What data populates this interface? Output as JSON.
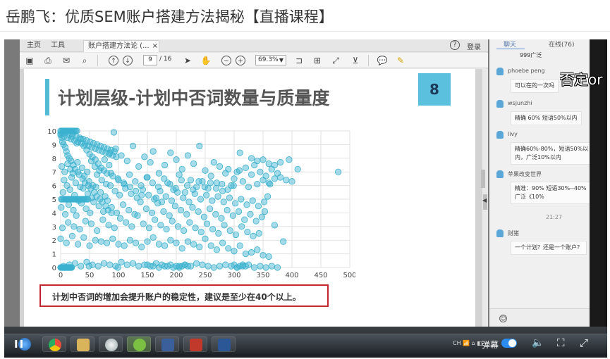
{
  "page": {
    "title": "岳鹏飞：优质SEM账户搭建方法揭秘【直播课程】"
  },
  "pdf": {
    "tabs": {
      "home": "主页",
      "tools": "工具",
      "doc": "账户搭建方法论 (...",
      "close": "×"
    },
    "help": "?",
    "login": "登录",
    "page_current": "9",
    "page_total": "/ 16",
    "zoom": "69.3%",
    "icons": [
      "save-icon",
      "print-icon",
      "mail-icon",
      "search-icon",
      "up-arrow-icon",
      "down-arrow-icon",
      "pointer-icon",
      "hand-icon",
      "zoom-out-icon",
      "zoom-in-icon",
      "fit-page-icon",
      "fit-width-icon",
      "fullscreen-icon",
      "tools-icon",
      "comment-icon",
      "highlighter-icon"
    ]
  },
  "slide": {
    "number": "8",
    "title": "计划层级-计划中否词数量与质量度",
    "note": "计划中否词的增加会提升账户的稳定性，建议是至少在40个以上。"
  },
  "chart_data": {
    "type": "scatter",
    "title": "",
    "xlabel": "",
    "ylabel": "",
    "xlim": [
      0,
      500
    ],
    "ylim": [
      0,
      10
    ],
    "xticks": [
      0,
      50,
      100,
      150,
      200,
      250,
      300,
      350,
      400,
      450,
      500
    ],
    "yticks": [
      0,
      1,
      2,
      3,
      4,
      5,
      6,
      7,
      8,
      9,
      10
    ],
    "grid": true,
    "marker_color": "#3ab1cf",
    "x": [
      0,
      2,
      3,
      5,
      8,
      10,
      12,
      15,
      18,
      20,
      22,
      25,
      28,
      30,
      32,
      35,
      38,
      40,
      42,
      45,
      48,
      50,
      52,
      55,
      58,
      60,
      62,
      65,
      68,
      70,
      72,
      75,
      78,
      80,
      82,
      85,
      88,
      90,
      95,
      100,
      105,
      110,
      115,
      120,
      125,
      130,
      135,
      140,
      145,
      150,
      155,
      160,
      165,
      170,
      175,
      180,
      185,
      190,
      195,
      200,
      205,
      210,
      215,
      220,
      225,
      230,
      235,
      240,
      245,
      250,
      255,
      260,
      265,
      270,
      275,
      280,
      285,
      290,
      295,
      300,
      305,
      310,
      315,
      320,
      325,
      330,
      335,
      340,
      345,
      350,
      355,
      360,
      365,
      370,
      375,
      380,
      390,
      400,
      480,
      5,
      15,
      25,
      35,
      45,
      55,
      65,
      75,
      85,
      95,
      105,
      115,
      125,
      135,
      145,
      155,
      165,
      175,
      185,
      195,
      205,
      215,
      225,
      235,
      245,
      255,
      265,
      275,
      285,
      295,
      305,
      315,
      325,
      335,
      345,
      355,
      365,
      375,
      385,
      0,
      10,
      20,
      30,
      40,
      50,
      60,
      70,
      80,
      90,
      100,
      110,
      120,
      130,
      140,
      150,
      160,
      170,
      180,
      190,
      200,
      210,
      220,
      230,
      240,
      250,
      260,
      270,
      280,
      290,
      300,
      310,
      320,
      330,
      340,
      350,
      360,
      370,
      3,
      13,
      23,
      33,
      43,
      53,
      63,
      73,
      83,
      93,
      103,
      113,
      123,
      133,
      143,
      153,
      163,
      173,
      183,
      193,
      203,
      213,
      223,
      233,
      243,
      253,
      263,
      273,
      283,
      293,
      303,
      313,
      323,
      333,
      343,
      353,
      1,
      8,
      14,
      22,
      27,
      36,
      44,
      51,
      57,
      66,
      74,
      81,
      88,
      97,
      108,
      118,
      128,
      138,
      148,
      158,
      168,
      178,
      188,
      198,
      208,
      218,
      228,
      238,
      248,
      258,
      268,
      278,
      288,
      298,
      308,
      318,
      328,
      338,
      348,
      358,
      4,
      9,
      16,
      24,
      31,
      39,
      47,
      54,
      61,
      69,
      77,
      86,
      94,
      102,
      112,
      122,
      132,
      142,
      152,
      162,
      172,
      182,
      192,
      202,
      212,
      222,
      232,
      242,
      252,
      262,
      272,
      282,
      292,
      302,
      312,
      322,
      332,
      342,
      352,
      362,
      6,
      11,
      19,
      26,
      34,
      41,
      49,
      56,
      63,
      71,
      79,
      87,
      99,
      109,
      119,
      129,
      139,
      149,
      159,
      169,
      179,
      189,
      199,
      209,
      219,
      229,
      239,
      249,
      259,
      269,
      279,
      289,
      299,
      309,
      2,
      7,
      12,
      17,
      21,
      29,
      37,
      46,
      53,
      59,
      67,
      76,
      84,
      92,
      0,
      3,
      6,
      9,
      12,
      15,
      18,
      21,
      24,
      27,
      30,
      33,
      36,
      39,
      42,
      45,
      48,
      51,
      54,
      57,
      60,
      63,
      66,
      69,
      72,
      75,
      78,
      81,
      84,
      87,
      90,
      93,
      96,
      99,
      0,
      1,
      2,
      3,
      4,
      5,
      6,
      7,
      8,
      9,
      10,
      11,
      12,
      13,
      14,
      15,
      16,
      17,
      18,
      19,
      20,
      0,
      2,
      4,
      6,
      8,
      10,
      12,
      14,
      16,
      18,
      20,
      22,
      24,
      26,
      28,
      30,
      1,
      3,
      5,
      7,
      9,
      11,
      13,
      15,
      17,
      19,
      21,
      23,
      25,
      27,
      29,
      31,
      33,
      35,
      37,
      39,
      41,
      43,
      45,
      47,
      49,
      150,
      160,
      170,
      180,
      190,
      200,
      205,
      210,
      215,
      220,
      300,
      305,
      310,
      315,
      320,
      330,
      340,
      350,
      360,
      370,
      380,
      395,
      410,
      480
    ],
    "y": [
      9.8,
      9.5,
      9.2,
      9.0,
      8.8,
      8.5,
      8.2,
      8.0,
      7.8,
      9.6,
      7.5,
      7.2,
      9.1,
      7.0,
      6.8,
      9.4,
      6.5,
      8.9,
      6.2,
      8.6,
      6.0,
      8.3,
      5.8,
      8.1,
      5.5,
      7.9,
      5.2,
      7.6,
      5.0,
      7.3,
      4.8,
      7.1,
      4.5,
      6.9,
      4.2,
      8.4,
      4.0,
      6.7,
      8.7,
      6.4,
      8.2,
      6.1,
      7.8,
      5.9,
      8.9,
      5.6,
      7.4,
      5.3,
      8.1,
      6.6,
      7.7,
      8.5,
      5.1,
      6.9,
      4.8,
      7.5,
      6.2,
      8.4,
      5.7,
      7.9,
      6.8,
      7.2,
      5.5,
      8.2,
      6.4,
      7.6,
      5.9,
      8.9,
      6.3,
      7.1,
      5.8,
      6.7,
      7.7,
      6.2,
      7.4,
      5.6,
      6.9,
      7.2,
      6.0,
      6.5,
      7.0,
      8.4,
      6.3,
      7.3,
      5.9,
      6.8,
      7.5,
      6.1,
      7.0,
      6.4,
      6.7,
      6.2,
      7.2,
      6.5,
      6.9,
      6.6,
      6.4,
      6.3,
      7.0,
      0.1,
      0.2,
      0.3,
      0.1,
      0.4,
      0.2,
      0.1,
      0.3,
      0.2,
      0.1,
      0.4,
      0.2,
      0.3,
      0.1,
      0.2,
      0.1,
      0.3,
      0.2,
      0.1,
      0.0,
      0.1,
      0.2,
      0.1,
      0.3,
      0.2,
      0.1,
      0.0,
      0.1,
      0.2,
      0.1,
      0.0,
      0.1,
      0.2,
      0.0,
      0.1,
      0.0,
      0.1,
      0.0,
      1.9,
      2.1,
      1.8,
      2.3,
      1.7,
      2.2,
      1.6,
      2.0,
      1.9,
      1.8,
      2.1,
      1.7,
      1.6,
      2.0,
      1.8,
      1.5,
      1.9,
      2.2,
      1.7,
      1.6,
      2.0,
      1.8,
      1.4,
      1.9,
      1.7,
      1.5,
      2.1,
      1.6,
      1.3,
      1.8,
      1.4,
      1.2,
      1.6,
      1.0,
      1.1,
      1.3,
      0.9,
      0.8,
      3.1,
      2.9,
      3.3,
      3.0,
      2.8,
      3.4,
      3.2,
      2.7,
      3.5,
      3.1,
      2.9,
      3.6,
      3.3,
      3.0,
      3.8,
      3.2,
      2.9,
      3.5,
      3.1,
      2.8,
      3.4,
      3.0,
      2.7,
      3.3,
      2.9,
      2.6,
      3.2,
      2.8,
      2.5,
      3.1,
      2.7,
      2.4,
      3.0,
      2.6,
      2.3,
      2.5,
      4.1,
      4.4,
      3.9,
      4.6,
      4.2,
      3.8,
      4.7,
      4.3,
      4.0,
      4.8,
      4.5,
      4.1,
      4.9,
      4.4,
      4.0,
      4.6,
      4.2,
      3.9,
      4.8,
      4.3,
      4.0,
      4.7,
      4.1,
      3.8,
      4.5,
      4.2,
      3.9,
      4.4,
      4.1,
      3.7,
      4.3,
      3.9,
      3.6,
      4.2,
      3.8,
      4.1,
      3.5,
      3.9,
      3.4,
      3.7,
      5.2,
      5.5,
      5.0,
      5.7,
      5.3,
      4.9,
      5.8,
      5.4,
      5.1,
      5.9,
      5.5,
      5.2,
      6.0,
      5.6,
      5.3,
      5.8,
      5.4,
      5.1,
      5.7,
      5.3,
      5.0,
      5.6,
      5.2,
      4.9,
      5.5,
      5.1,
      4.8,
      5.4,
      5.0,
      5.3,
      4.9,
      5.2,
      4.8,
      5.1,
      4.7,
      5.0,
      4.6,
      4.9,
      4.5,
      4.8,
      6.1,
      6.4,
      6.0,
      6.6,
      6.2,
      5.9,
      6.7,
      6.3,
      6.0,
      6.8,
      6.4,
      6.1,
      6.9,
      6.5,
      6.2,
      6.8,
      6.3,
      6.0,
      6.6,
      6.2,
      5.9,
      6.5,
      6.1,
      5.8,
      6.4,
      6.0,
      5.7,
      6.3,
      5.9,
      6.2,
      5.8,
      6.1,
      5.7,
      6.0,
      7.1,
      7.4,
      7.0,
      7.6,
      7.2,
      6.9,
      7.7,
      7.3,
      7.0,
      7.8,
      7.4,
      7.1,
      7.9,
      7.5,
      9.9,
      9.7,
      9.8,
      9.6,
      9.9,
      9.5,
      9.7,
      9.4,
      9.8,
      9.3,
      9.6,
      9.2,
      9.5,
      9.1,
      9.4,
      9.0,
      9.3,
      8.9,
      9.2,
      8.8,
      9.1,
      8.7,
      9.0,
      8.6,
      8.9,
      8.5,
      8.8,
      8.4,
      8.7,
      8.3,
      8.6,
      8.2,
      8.5,
      8.1,
      0.0,
      0.0,
      0.0,
      0.0,
      0.0,
      0.0,
      0.0,
      0.0,
      0.0,
      0.0,
      0.0,
      0.0,
      0.0,
      0.0,
      0.0,
      0.0,
      0.0,
      0.0,
      0.0,
      0.0,
      0.0,
      10.0,
      10.0,
      10.0,
      10.0,
      10.0,
      10.0,
      10.0,
      10.0,
      10.0,
      10.0,
      10.0,
      10.0,
      10.0,
      10.0,
      10.0,
      10.0,
      5.0,
      5.0,
      5.0,
      5.0,
      5.0,
      5.0,
      5.0,
      5.0,
      5.0,
      5.0,
      5.0,
      5.0,
      5.0,
      5.0,
      5.0,
      5.0,
      5.0,
      5.0,
      5.0,
      5.0,
      5.0,
      5.0,
      5.0,
      5.0,
      5.0,
      0.1,
      0.2,
      0.1,
      0.0,
      0.1,
      0.2,
      0.1,
      0.0,
      0.1,
      0.2,
      0.1,
      0.2,
      0.0,
      0.1,
      0.2,
      0.1,
      8.0,
      7.8,
      7.9,
      7.6,
      7.5,
      7.7,
      7.9,
      7.2
    ]
  },
  "chat": {
    "tab_chat": "聊天",
    "tab_online": "在线(76)",
    "messages": [
      {
        "user": "",
        "text": "999广泛"
      },
      {
        "user": "phoebe peng",
        "text": "可以在的一次吗"
      },
      {
        "user": "wsjunzhi",
        "text": "精确 60% 短语50%以内"
      },
      {
        "user": "livy",
        "text": "精确60%-80%，短语50%以",
        "text2": "内，广泛10%以内"
      },
      {
        "user": "苹果改变世界",
        "text": "精准：90% 短语30%--40%",
        "text2": "广泛《10%"
      },
      {
        "user": "财猪",
        "text": "一个计划？还是一个账户？"
      }
    ],
    "time": "21:27",
    "overlay": "否定or"
  },
  "player": {
    "danmu_label": "弹幕",
    "tray_text": "CH 📶 ⌂ ◧"
  }
}
